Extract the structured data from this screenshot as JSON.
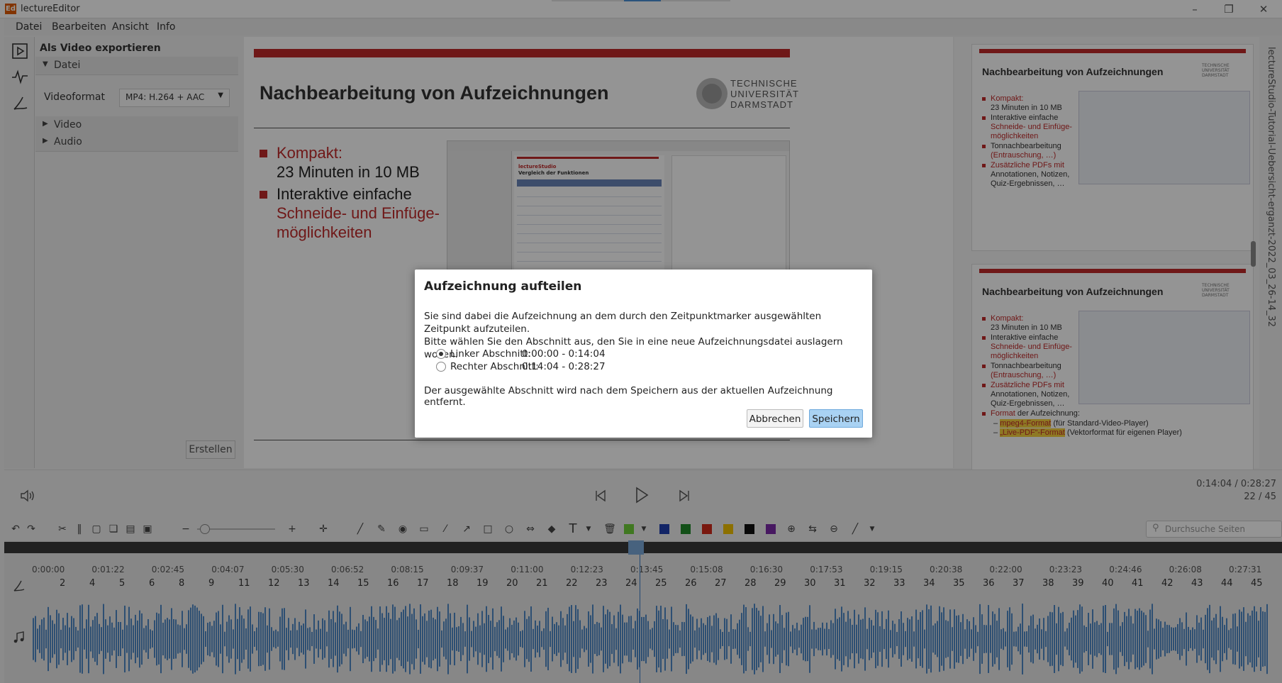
{
  "window": {
    "app_icon": "Ed",
    "title": "lectureEditor",
    "controls": {
      "minimize": "–",
      "restore": "❐",
      "close": "✕"
    }
  },
  "menu": [
    "Datei",
    "Bearbeiten",
    "Ansicht",
    "Info"
  ],
  "left_icons": [
    "play-icon",
    "waveform-icon",
    "pen-icon"
  ],
  "export_panel": {
    "title": "Als Video exportieren",
    "section_file": "Datei",
    "videoformat_label": "Videoformat",
    "videoformat_value": "MP4: H.264 + AAC",
    "section_video": "Video",
    "section_audio": "Audio",
    "create_button": "Erstellen"
  },
  "slide": {
    "title": "Nachbearbeitung von Aufzeichnungen",
    "logo_lines": [
      "TECHNISCHE",
      "UNIVERSITÄT",
      "DARMSTADT"
    ],
    "bullet1_a": "Kompakt:",
    "bullet1_b": "23 Minuten in 10 MB",
    "bullet2_a": "Interaktive einfache",
    "bullet2_b": "Schneide- und Einfüge-",
    "bullet2_c": "möglichkeiten",
    "embed_title_a": "lectureStudio",
    "embed_title_b": "Vergleich der Funktionen"
  },
  "preview": {
    "card_title": "Nachbearbeitung von Aufzeichnungen",
    "item1_a": "Kompakt:",
    "item1_b": "23 Minuten in 10 MB",
    "item2_a": "Interaktive einfache",
    "item2_b": "Schneide- und Einfüge-",
    "item2_c": "möglichkeiten",
    "item3_a": "Tonnachbearbeitung",
    "item3_b": "(Entrauschung, …)",
    "item4_a": "Zusätzliche PDFs mit",
    "item4_b": "Annotationen, Notizen,",
    "item4_c": "Quiz-Ergebnissen, …",
    "item5_a": "Format",
    "item5_b": " der Aufzeichnung:",
    "sub1_hl": "mpeg4-Format",
    "sub1_rest": " (für Standard-Video-Player)",
    "sub2_hl": "„Live-PDF“-Format",
    "sub2_rest": " (Vektorformat für eigenen Player)",
    "vertical_label": "lectureStudio-Tutorial-Uebersicht-erganzt-2022_03_26-14_32"
  },
  "playback": {
    "time": "0:14:04 / 0:28:27",
    "page": "22 / 45"
  },
  "toolbar": {
    "search_placeholder": "Durchsuche Seiten",
    "colors": [
      "#1f3fb0",
      "#1f8a2a",
      "#d12a1a",
      "#f2c200",
      "#111111",
      "#7b2aa8"
    ]
  },
  "timeline": {
    "ticks": [
      "0:00:00",
      "0:01:22",
      "0:02:45",
      "0:04:07",
      "0:05:30",
      "0:06:52",
      "0:08:15",
      "0:09:37",
      "0:11:00",
      "0:12:23",
      "0:13:45",
      "0:15:08",
      "0:16:30",
      "0:17:53",
      "0:19:15",
      "0:20:38",
      "0:22:00",
      "0:23:23",
      "0:24:46",
      "0:26:08",
      "0:27:31"
    ],
    "segments": [
      "2",
      "4",
      "5",
      "6",
      "8",
      "9",
      "11",
      "12",
      "13",
      "14",
      "15",
      "16",
      "17",
      "18",
      "19",
      "20",
      "21",
      "22",
      "23",
      "24",
      "25",
      "26",
      "27",
      "28",
      "29",
      "30",
      "31",
      "32",
      "33",
      "34",
      "35",
      "36",
      "37",
      "38",
      "39",
      "40",
      "41",
      "42",
      "43",
      "44",
      "45"
    ]
  },
  "dialog": {
    "title": "Aufzeichnung aufteilen",
    "text1": "Sie sind dabei die Aufzeichnung an dem durch den Zeitpunktmarker ausgewählten Zeitpunkt aufzuteilen.",
    "text2": "Bitte wählen Sie den Abschnitt aus, den Sie in eine neue Aufzeichnungsdatei auslagern wollen.",
    "left_label": "Linker Abschnitt:",
    "left_range": "0:00:00 - 0:14:04",
    "right_label": "Rechter Abschnitt:",
    "right_range": "0:14:04 - 0:28:27",
    "note": "Der ausgewählte Abschnitt wird nach dem Speichern aus der aktuellen Aufzeichnung entfernt.",
    "cancel": "Abbrechen",
    "save": "Speichern"
  }
}
